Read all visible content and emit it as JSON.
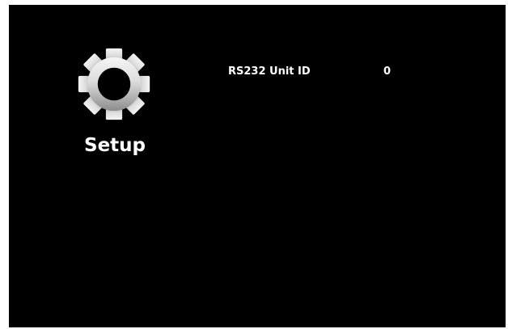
{
  "menu": {
    "section_icon": "gear-icon",
    "section_title": "Setup"
  },
  "settings": [
    {
      "label": "RS232 Unit ID",
      "value": "0"
    }
  ],
  "colors": {
    "background": "#000000",
    "text": "#ffffff",
    "icon_light": "#f5f5f5",
    "icon_dark": "#8c8c8c"
  }
}
